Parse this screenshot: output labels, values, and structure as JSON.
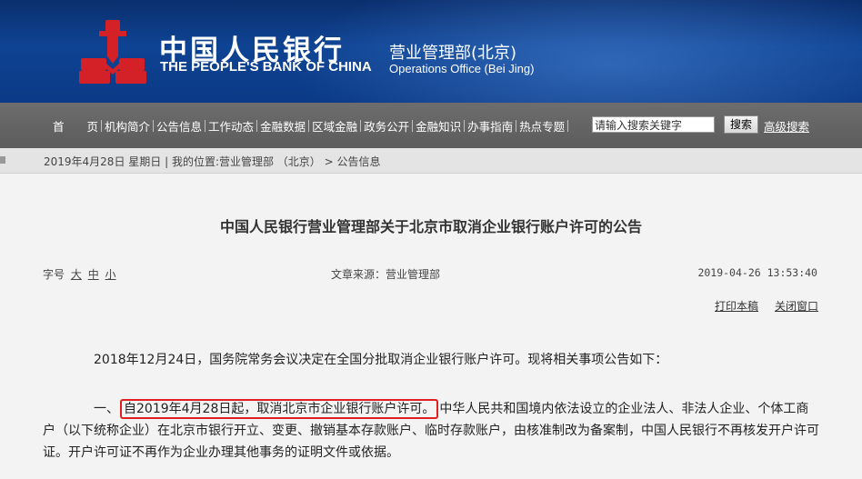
{
  "header": {
    "title_cn": "中国人民银行",
    "title_en": "THE PEOPLE'S BANK OF CHINA",
    "office_cn": "营业管理部(北京)",
    "office_en": "Operations Office (Bei Jing)",
    "brand_color": "#0e4393",
    "logo_color": "#d42027"
  },
  "nav": {
    "items": [
      "首　　页",
      "机构简介",
      "公告信息",
      "工作动态",
      "金融数据",
      "区域金融",
      "政务公开",
      "金融知识",
      "办事指南",
      "热点专题"
    ],
    "search_placeholder": "请输入搜索关键字",
    "search_button": "搜索",
    "advanced_search": "高级搜索"
  },
  "crumb": {
    "date": "2019年4月28日 星期日",
    "location": "我的位置:营业管理部 （北京） > 公告信息"
  },
  "article": {
    "title": "中国人民银行营业管理部关于北京市取消企业银行账户许可的公告",
    "font_label": "字号",
    "font_sizes": [
      "大",
      "中",
      "小"
    ],
    "source": "文章来源：营业管理部",
    "datetime": "2019-04-26 13:53:40",
    "print": "打印本稿",
    "close": "关闭窗口",
    "para1": "2018年12月24日，国务院常务会议决定在全国分批取消企业银行账户许可。现将相关事项公告如下：",
    "para2_prefix": "一、",
    "para2_highlight": "自2019年4月28日起，取消北京市企业银行账户许可。",
    "para2_rest": "中华人民共和国境内依法设立的企业法人、非法人企业、个体工商户（以下统称企业）在北京市银行开立、变更、撤销基本存款账户、临时存款账户，由核准制改为备案制，中国人民银行不再核发开户许可证。开户许可证不再作为企业办理其他事务的证明文件或依据。",
    "highlight_color": "#e02020"
  }
}
